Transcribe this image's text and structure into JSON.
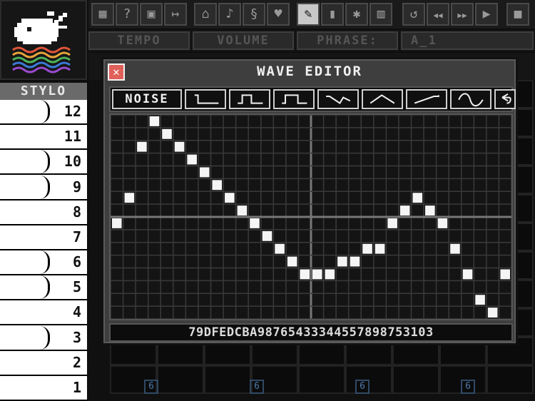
{
  "left_panel": {
    "instrument_label": "STYLO",
    "keys": [
      "12",
      "11",
      "10",
      "9",
      "8",
      "7",
      "6",
      "5",
      "4",
      "3",
      "2",
      "1"
    ]
  },
  "toolbar": {
    "icons": [
      "grid-icon",
      "help-icon",
      "save-icon",
      "export-icon",
      "piano-icon",
      "note-icon",
      "clef-icon",
      "bird-icon",
      "pencil-icon",
      "eraser-icon",
      "star-icon",
      "trash-icon",
      "undo-icon",
      "rewind-icon",
      "fast-forward-icon",
      "play-icon",
      "stop-icon"
    ]
  },
  "second_bar": {
    "tempo_label": "TEMPO",
    "volume_label": "VOLUME",
    "phrase_label": "PHRASE:",
    "phrase_value": "A_1"
  },
  "wave_editor": {
    "title": "WAVE EDITOR",
    "close_symbol": "✕",
    "presets": [
      {
        "name": "noise",
        "label": "NOISE"
      },
      {
        "name": "pulse-12",
        "label": ""
      },
      {
        "name": "pulse-25",
        "label": ""
      },
      {
        "name": "square",
        "label": ""
      },
      {
        "name": "sawtooth-down",
        "label": ""
      },
      {
        "name": "triangle",
        "label": ""
      },
      {
        "name": "sawtooth-up",
        "label": ""
      },
      {
        "name": "sine",
        "label": ""
      },
      {
        "name": "reset",
        "label": ""
      }
    ],
    "samples": [
      7,
      9,
      13,
      15,
      14,
      13,
      12,
      11,
      10,
      9,
      8,
      7,
      6,
      5,
      4,
      3,
      3,
      3,
      4,
      4,
      5,
      5,
      7,
      8,
      9,
      8,
      7,
      5,
      3,
      1,
      0,
      3
    ],
    "grid_rows": 16,
    "hex_readout": "79DFEDCBA9876543334455789875310З"
  }
}
